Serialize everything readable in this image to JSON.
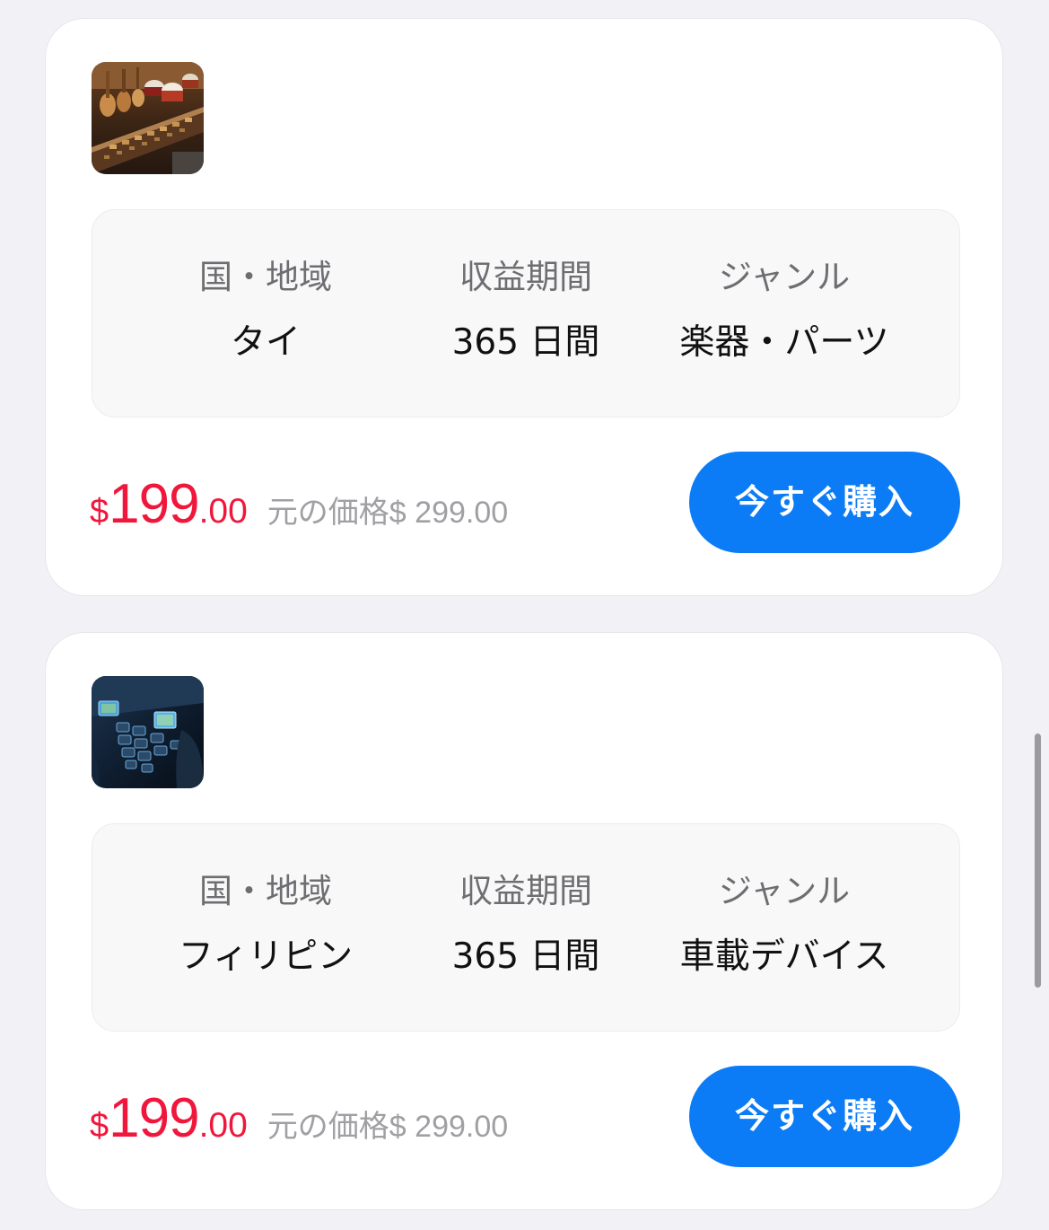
{
  "products": [
    {
      "image_icon": "musical-instruments-thumbnail",
      "labels": {
        "region": "国・地域",
        "period": "収益期間",
        "genre": "ジャンル"
      },
      "values": {
        "region": "タイ",
        "period": "365 日間",
        "genre": "楽器・パーツ"
      },
      "price": {
        "currency": "$",
        "integer": "199",
        "decimal": ".00",
        "original_label": "元の価格$ 299.00"
      },
      "buy_label": "今すぐ購入"
    },
    {
      "image_icon": "car-devices-thumbnail",
      "labels": {
        "region": "国・地域",
        "period": "収益期間",
        "genre": "ジャンル"
      },
      "values": {
        "region": "フィリピン",
        "period": "365 日間",
        "genre": "車載デバイス"
      },
      "price": {
        "currency": "$",
        "integer": "199",
        "decimal": ".00",
        "original_label": "元の価格$ 299.00"
      },
      "buy_label": "今すぐ購入"
    }
  ],
  "colors": {
    "page_background": "#f1f1f6",
    "price_red": "#f0173c",
    "button_blue": "#0b7cf5",
    "muted_text": "#a0a0a4"
  }
}
